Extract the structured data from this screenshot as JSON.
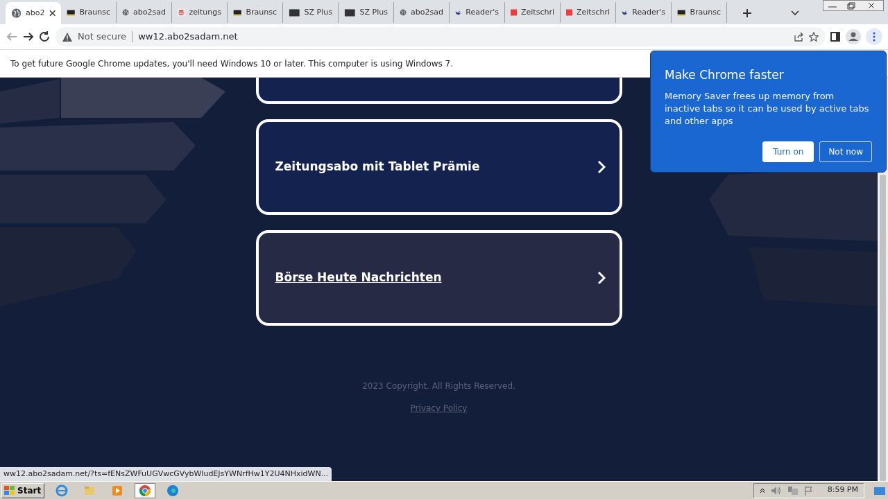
{
  "tabs": [
    {
      "title": "abo2",
      "kind": "globe",
      "selected": true
    },
    {
      "title": "Braunsc",
      "kind": "bz",
      "selected": false
    },
    {
      "title": "abo2sad",
      "kind": "globe",
      "selected": false
    },
    {
      "title": "zeitungs",
      "kind": "brands",
      "selected": false
    },
    {
      "title": "Braunsc",
      "kind": "bz",
      "selected": false
    },
    {
      "title": "SZ Plus",
      "kind": "sz",
      "selected": false
    },
    {
      "title": "SZ Plus",
      "kind": "sz",
      "selected": false
    },
    {
      "title": "abo2sad",
      "kind": "globe",
      "selected": false
    },
    {
      "title": "Reader's",
      "kind": "bird",
      "selected": false
    },
    {
      "title": "Zeitschri",
      "kind": "red",
      "selected": false
    },
    {
      "title": "Zeitschri",
      "kind": "red",
      "selected": false
    },
    {
      "title": "Reader's",
      "kind": "bird",
      "selected": false
    },
    {
      "title": "Braunsc",
      "kind": "bz",
      "selected": false
    }
  ],
  "toolbar": {
    "security": "Not secure",
    "url": "ww12.abo2sadam.net"
  },
  "infobar": {
    "text": "To get future Google Chrome updates, you'll need Windows 10 or later. This computer is using Windows 7."
  },
  "cards": [
    {
      "kind": "clipped"
    },
    {
      "kind": "link",
      "label": "Zeitungsabo mit Tablet Prämie",
      "hovered": false
    },
    {
      "kind": "link",
      "label": "Börse Heute Nachrichten",
      "hovered": true
    }
  ],
  "footer": {
    "copyright": "2023 Copyright. All Rights Reserved.",
    "privacy": "Privacy Policy"
  },
  "status_url": "ww12.abo2sadam.net/?ts=fENsZWFuUGVwcGVybWludEJsYWNrfHw1Y2U4NHxidWN...",
  "popup": {
    "title": "Make Chrome faster",
    "body": "Memory Saver frees up memory from inactive tabs so it can be used by active tabs and other apps",
    "buttons": [
      {
        "label": "Turn on",
        "kind": "primary"
      },
      {
        "label": "Not now",
        "kind": "outline"
      }
    ]
  },
  "taskbar": {
    "start": "Start",
    "apps": [
      {
        "kind": "ie",
        "selected": false
      },
      {
        "kind": "folder",
        "selected": false
      },
      {
        "kind": "media",
        "selected": false
      },
      {
        "kind": "chrome",
        "selected": true
      },
      {
        "kind": "edge",
        "selected": false
      }
    ],
    "time": "8:59 PM"
  }
}
